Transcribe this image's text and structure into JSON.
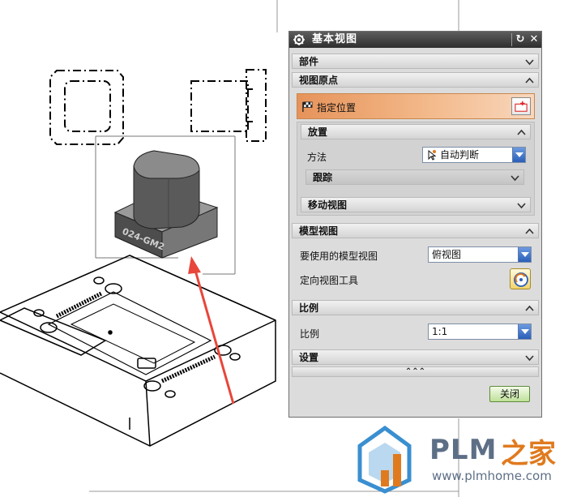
{
  "dialog": {
    "title": "基本视图",
    "close_label": "关闭",
    "sections": {
      "part": "部件",
      "view_origin": "视图原点",
      "model_view": "模型视图",
      "scale": "比例",
      "settings": "设置"
    },
    "view_origin": {
      "specify_location": "指定位置",
      "placement": "放置",
      "method_label": "方法",
      "method_value": "自动判断",
      "tracking": "跟踪",
      "move_view": "移动视图"
    },
    "model_view": {
      "model_view_label": "要使用的模型视图",
      "model_view_value": "俯视图",
      "orient_tool_label": "定向视图工具"
    },
    "scale": {
      "scale_label": "比例",
      "scale_value": "1:1"
    },
    "more_glyph": "⌃⌃⌃"
  },
  "drawing": {
    "part_engraving": "024-GM2"
  },
  "watermark": {
    "brand": "PLM",
    "brand_cn": "之家",
    "url": "www.plmhome.com"
  },
  "colors": {
    "title_bar": "#3f3f3f",
    "highlight_row": "#f0b27e",
    "arrow": "#e8463a",
    "close_button": "#bfe19a",
    "logo_blue": "#3a8fd0",
    "logo_orange": "#e07a1f"
  }
}
